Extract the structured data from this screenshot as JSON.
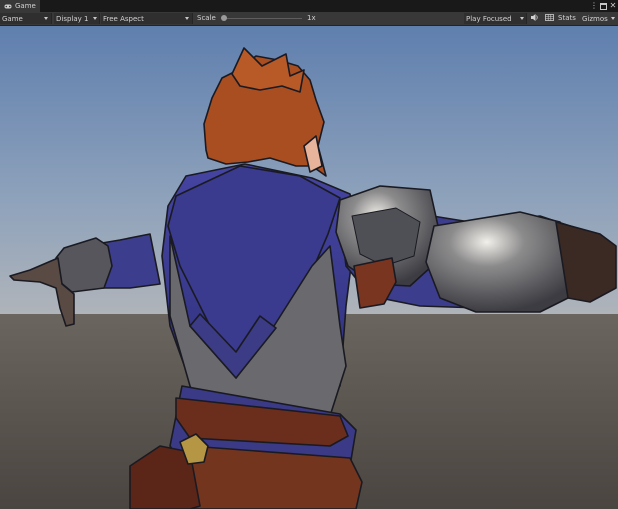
{
  "window": {
    "tab_title": "Game",
    "tab_icon": "gamepad-icon",
    "controls": [
      "more-options-icon",
      "maximize-icon",
      "close-icon"
    ]
  },
  "toolbar": {
    "view_mode": "Game",
    "display": "Display 1",
    "aspect": "Free Aspect",
    "scale_label": "Scale",
    "scale_value": "1x",
    "scale_level": 0,
    "play_mode": "Play Focused",
    "audio_icon": "speaker-icon",
    "stats_icon": "grid-icon",
    "stats_label": "Stats",
    "gizmos_label": "Gizmos"
  },
  "viewport": {
    "scene": "stylized armored character, back view, T-pose",
    "colors": {
      "sky_top": "#5f7fae",
      "sky_bottom": "#a9b1bb",
      "ground": "#59534d",
      "tunic": "#3f3f97",
      "hair": "#a94e20",
      "armor": "#5f5f63",
      "leather": "#6b2e1c"
    }
  }
}
